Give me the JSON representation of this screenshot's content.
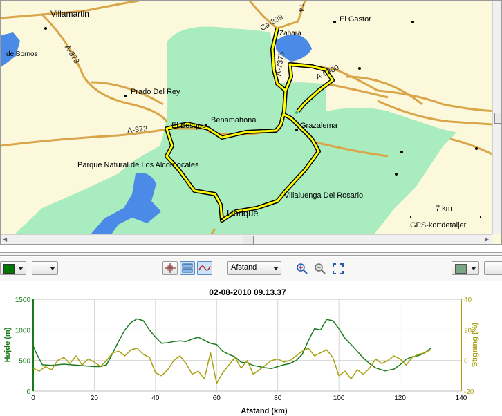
{
  "map": {
    "places": [
      {
        "name": "Villamartin"
      },
      {
        "name": "El Gastor"
      },
      {
        "name": "Zahara"
      },
      {
        "name": "de Bornos"
      },
      {
        "name": "Prado Del Rey"
      },
      {
        "name": "Benamahona"
      },
      {
        "name": "El Bosque"
      },
      {
        "name": "Grazalema"
      },
      {
        "name": "Parque Natural de Los Alcornocales"
      },
      {
        "name": "Villaluenga Del Rosario"
      },
      {
        "name": "Ubrique"
      }
    ],
    "roads": [
      "A-373",
      "A-372",
      "Ca-339",
      "A-7375",
      "A-6300",
      "14"
    ],
    "scale_label": "7 km",
    "attribution": "GPS-kortdetaljer",
    "colors": {
      "background": "#fbf8dc",
      "park": "#a8ecc0",
      "water": "#4c8ae8",
      "road": "#d9a548",
      "track": "#ffff00"
    }
  },
  "toolbar": {
    "color_picker_left": {
      "color": "#007800",
      "icon": "color-swatch"
    },
    "blank_dropdown_label": "",
    "mode_buttons": [
      "crosshair-icon",
      "stacked-view-icon",
      "line-graph-icon"
    ],
    "x_axis_select": "Afstand",
    "zoom_in": "zoom-in-icon",
    "zoom_out": "zoom-out-icon",
    "zoom_fit": "zoom-fit-icon",
    "color_picker_right": {
      "color": "#7aa684"
    }
  },
  "chart_data": {
    "type": "line",
    "title": "02-08-2010 09.13.37",
    "xlabel": "Afstand (km)",
    "ylabel_left": "Højde (m)",
    "ylabel_right": "Stigning (%)",
    "xlim": [
      0,
      140
    ],
    "ylim_left": [
      0,
      1500
    ],
    "ylim_right": [
      -20,
      40
    ],
    "x_ticks": [
      "0",
      "20",
      "40",
      "60",
      "80",
      "100",
      "120",
      "140"
    ],
    "y_left_ticks": [
      "0",
      "500",
      "1000",
      "1500"
    ],
    "y_right_ticks": [
      "-20",
      "0",
      "20",
      "40"
    ],
    "grid": true,
    "series": [
      {
        "name": "Højde (m)",
        "axis": "left",
        "color": "#1a7a1a",
        "x": [
          0,
          1,
          3,
          6,
          10,
          15,
          20,
          22,
          24,
          26,
          28,
          30,
          32,
          34,
          36,
          38,
          40,
          42,
          44,
          46,
          48,
          50,
          52,
          54,
          56,
          58,
          60,
          62,
          64,
          66,
          68,
          70,
          72,
          74,
          76,
          78,
          80,
          82,
          84,
          86,
          88,
          90,
          92,
          94,
          96,
          98,
          100,
          102,
          104,
          106,
          108,
          110,
          112,
          115,
          118,
          120,
          122,
          124,
          126,
          128,
          130
        ],
        "y": [
          740,
          620,
          430,
          420,
          440,
          420,
          400,
          400,
          430,
          620,
          820,
          1000,
          1120,
          1180,
          1150,
          1000,
          880,
          780,
          790,
          810,
          820,
          810,
          850,
          880,
          830,
          780,
          760,
          650,
          600,
          560,
          470,
          460,
          420,
          400,
          380,
          370,
          400,
          430,
          450,
          500,
          600,
          820,
          1020,
          1000,
          1170,
          1150,
          1020,
          860,
          760,
          650,
          540,
          450,
          380,
          330,
          360,
          430,
          520,
          560,
          580,
          620,
          700
        ]
      },
      {
        "name": "Stigning (%)",
        "axis": "right",
        "color": "#a8a010",
        "x": [
          0,
          2,
          4,
          6,
          8,
          10,
          12,
          14,
          16,
          18,
          20,
          22,
          24,
          26,
          28,
          30,
          32,
          34,
          36,
          38,
          40,
          42,
          44,
          46,
          48,
          50,
          52,
          54,
          56,
          58,
          60,
          62,
          64,
          66,
          68,
          70,
          72,
          74,
          76,
          78,
          80,
          82,
          84,
          86,
          88,
          90,
          92,
          94,
          96,
          98,
          100,
          102,
          104,
          106,
          108,
          110,
          112,
          114,
          116,
          118,
          120,
          122,
          124,
          126,
          128,
          130
        ],
        "y": [
          -5,
          -7,
          -4,
          -6,
          0,
          2,
          -2,
          3,
          -3,
          1,
          -1,
          -4,
          0,
          5,
          6,
          3,
          7,
          8,
          4,
          2,
          -8,
          -10,
          -6,
          0,
          3,
          -2,
          -9,
          -7,
          -12,
          5,
          -15,
          -8,
          -3,
          2,
          -5,
          0,
          -9,
          -6,
          -3,
          0,
          1,
          -1,
          0,
          3,
          6,
          8,
          3,
          5,
          7,
          2,
          -10,
          -7,
          -12,
          -6,
          -9,
          -5,
          1,
          -2,
          0,
          3,
          1,
          -3,
          2,
          4,
          5,
          7
        ]
      }
    ]
  }
}
